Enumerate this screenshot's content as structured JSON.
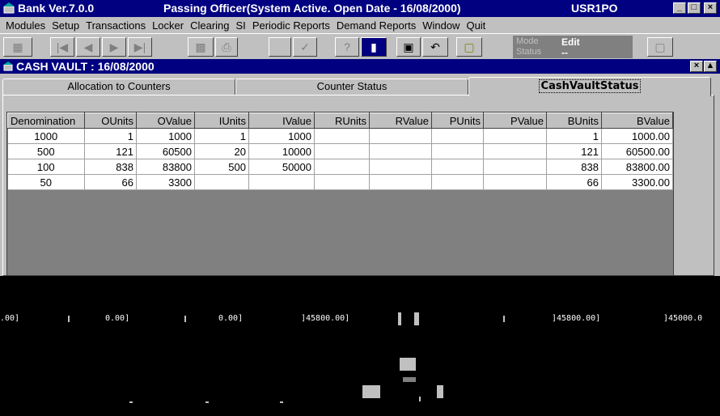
{
  "window": {
    "app_title": "Bank Ver.7.0.0",
    "status_title": "Passing Officer(System Active. Open Date - 16/08/2000)",
    "user": "USR1PO",
    "buttons": [
      "_",
      "□",
      "×"
    ]
  },
  "menu": [
    "Modules",
    "Setup",
    "Transactions",
    "Locker",
    "Clearing",
    "SI",
    "Periodic Reports",
    "Demand Reports",
    "Window",
    "Quit"
  ],
  "toolbar": {
    "mode_label": "Mode",
    "mode_value": "Edit",
    "status_label": "Status",
    "status_value": "--"
  },
  "child": {
    "title": "CASH VAULT : 16/08/2000",
    "tabs": [
      "Allocation to Counters",
      "Counter Status",
      "CashVaultStatus"
    ]
  },
  "grid": {
    "columns": [
      "Denomination",
      "OUnits",
      "OValue",
      "IUnits",
      "IValue",
      "RUnits",
      "RValue",
      "PUnits",
      "PValue",
      "BUnits",
      "BValue"
    ],
    "rows": [
      [
        "1000",
        "1",
        "1000",
        "1",
        "1000",
        "",
        "",
        "",
        "",
        "1",
        "1000.00"
      ],
      [
        "500",
        "121",
        "60500",
        "20",
        "10000",
        "",
        "",
        "",
        "",
        "121",
        "60500.00"
      ],
      [
        "100",
        "838",
        "83800",
        "500",
        "50000",
        "",
        "",
        "",
        "",
        "838",
        "83800.00"
      ],
      [
        "50",
        "66",
        "3300",
        "",
        "",
        "",
        "",
        "",
        "",
        "66",
        "3300.00"
      ]
    ]
  },
  "garbled": [
    ".00]",
    "0.00]",
    "0.00]",
    "]45800.00]",
    "]45800.00]",
    "]45000.0"
  ]
}
